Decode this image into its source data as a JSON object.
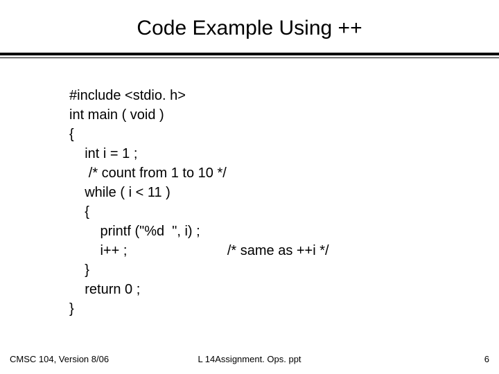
{
  "title": "Code Example Using ++",
  "code": {
    "l1": "#include <stdio. h>",
    "l2": "int main ( void )",
    "l3": "{",
    "l4": "    int i = 1 ;",
    "l5": "",
    "l6": "     /* count from 1 to 10 */",
    "l7": "    while ( i < 11 )",
    "l8": "    {",
    "l9": "        printf (\"%d  \", i) ;",
    "l10": "        i++ ;                          /* same as ++i */",
    "l11": "    }",
    "l12": "    return 0 ;",
    "l13": "}"
  },
  "footer": {
    "left": "CMSC 104, Version 8/06",
    "center": "L 14Assignment. Ops. ppt",
    "right": "6"
  }
}
